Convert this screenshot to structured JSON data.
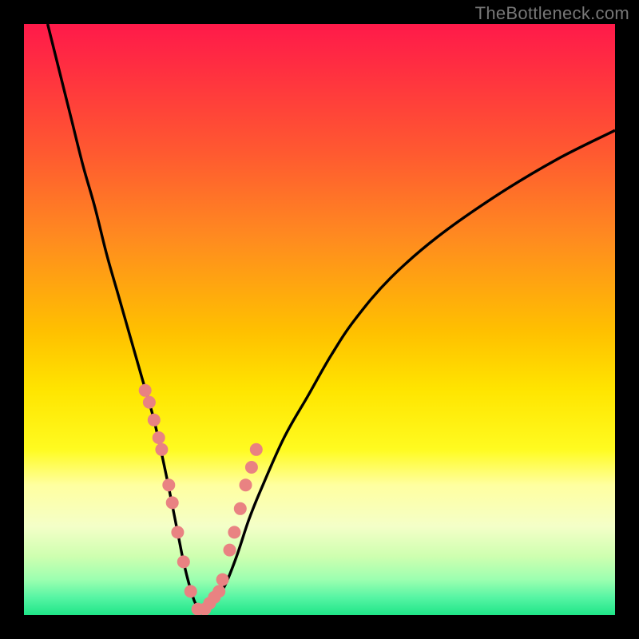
{
  "watermark": "TheBottleneck.com",
  "colors": {
    "curve": "#000000",
    "dot": "#e98282",
    "frame": "#000000"
  },
  "chart_data": {
    "type": "line",
    "title": "",
    "xlabel": "",
    "ylabel": "",
    "xlim": [
      0,
      100
    ],
    "ylim": [
      0,
      100
    ],
    "series": [
      {
        "name": "bottleneck-curve",
        "x": [
          4,
          6,
          8,
          10,
          12,
          14,
          16,
          18,
          20,
          22,
          24,
          26,
          27,
          28,
          29,
          30,
          31,
          32,
          34,
          36,
          38,
          40,
          44,
          48,
          52,
          56,
          62,
          70,
          80,
          90,
          100
        ],
        "y": [
          100,
          92,
          84,
          76,
          69,
          61,
          54,
          47,
          40,
          33,
          24,
          14,
          9,
          5,
          2,
          1,
          1,
          2,
          5,
          10,
          16,
          21,
          30,
          37,
          44,
          50,
          57,
          64,
          71,
          77,
          82
        ]
      }
    ],
    "markers": {
      "name": "highlight-dots",
      "x": [
        20.5,
        21.2,
        22.0,
        22.8,
        23.3,
        24.5,
        25.1,
        26.0,
        27.0,
        28.2,
        29.4,
        30.6,
        31.4,
        32.2,
        33.0,
        33.6,
        34.8,
        35.6,
        36.6,
        37.5,
        38.5,
        39.3
      ],
      "y": [
        38,
        36,
        33,
        30,
        28,
        22,
        19,
        14,
        9,
        4,
        1,
        1,
        2,
        3,
        4,
        6,
        11,
        14,
        18,
        22,
        25,
        28
      ]
    }
  }
}
